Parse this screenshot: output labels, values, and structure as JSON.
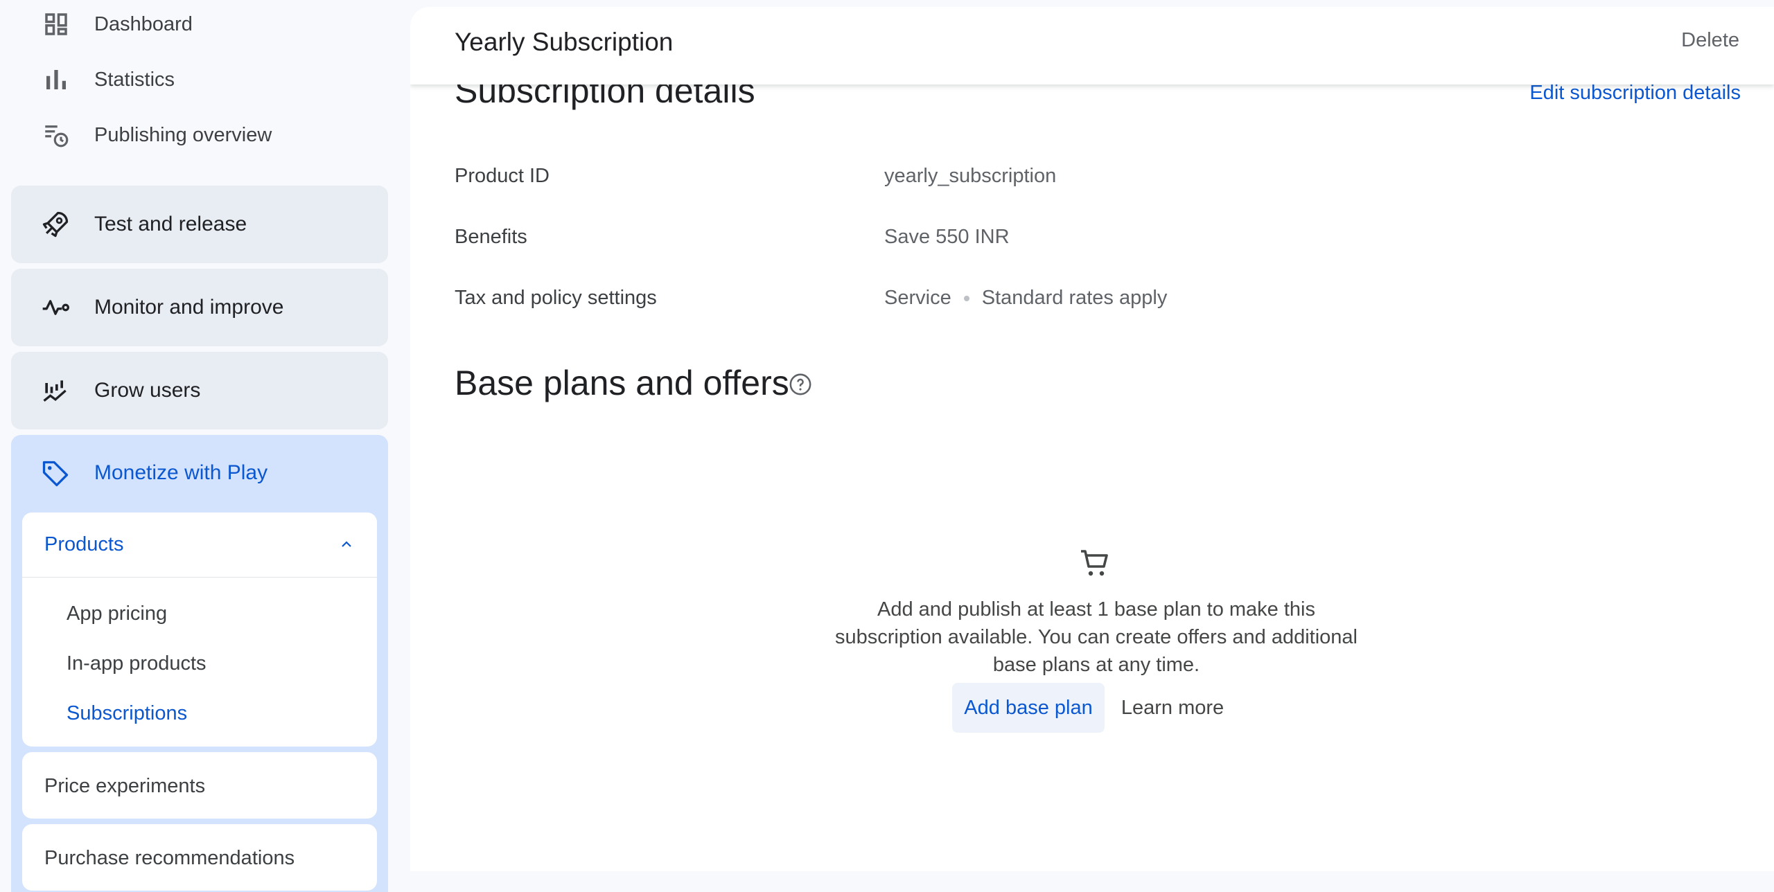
{
  "sidebar": {
    "top_items": [
      {
        "label": "Dashboard",
        "icon": "dashboard-icon"
      },
      {
        "label": "Statistics",
        "icon": "bar-chart-icon"
      },
      {
        "label": "Publishing overview",
        "icon": "publishing-overview-icon"
      }
    ],
    "sections": [
      {
        "label": "Test and release",
        "icon": "rocket-icon"
      },
      {
        "label": "Monitor and improve",
        "icon": "vitals-icon"
      },
      {
        "label": "Grow users",
        "icon": "grow-users-icon"
      },
      {
        "label": "Monetize with Play",
        "icon": "tag-icon"
      }
    ],
    "products": {
      "label": "Products",
      "items": [
        {
          "label": "App pricing"
        },
        {
          "label": "In-app products"
        },
        {
          "label": "Subscriptions"
        }
      ]
    },
    "price_experiments": "Price experiments",
    "purchase_recommendations": "Purchase recommendations"
  },
  "header": {
    "title": "Yearly Subscription",
    "delete_label": "Delete"
  },
  "details": {
    "title": "Subscription details",
    "edit_label": "Edit subscription details",
    "rows": [
      {
        "label": "Product ID",
        "value": "yearly_subscription"
      },
      {
        "label": "Benefits",
        "value": "Save 550 INR"
      },
      {
        "label": "Tax and policy settings",
        "value_a": "Service",
        "value_b": "Standard rates apply"
      }
    ]
  },
  "base_plans": {
    "title": "Base plans and offers",
    "empty_text": "Add and publish at least 1 base plan to make this subscription available. You can create offers and additional base plans at any time.",
    "add_label": "Add base plan",
    "learn_label": "Learn more"
  },
  "colors": {
    "accent": "#0b57d0",
    "active_section_bg": "#d3e3fd",
    "section_bg": "#e8ecf3"
  }
}
